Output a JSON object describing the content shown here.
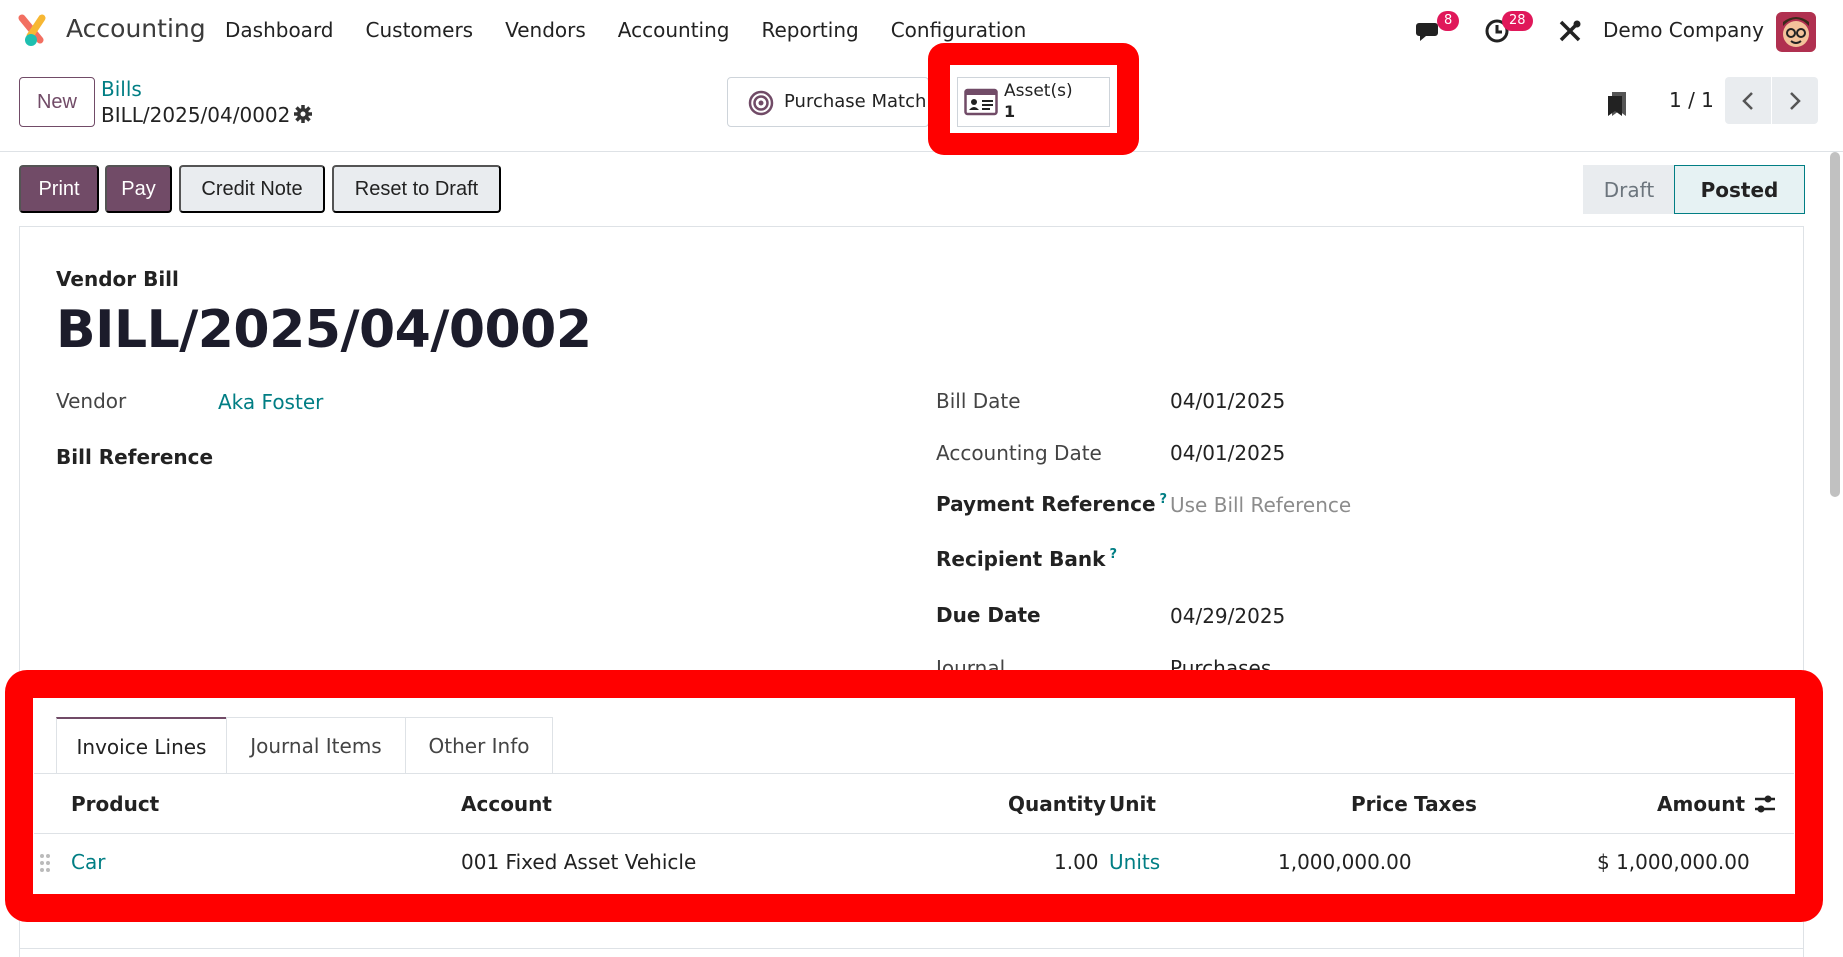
{
  "navbar": {
    "app_name": "Accounting",
    "menu": [
      "Dashboard",
      "Customers",
      "Vendors",
      "Accounting",
      "Reporting",
      "Configuration"
    ],
    "messages_count": "8",
    "activities_count": "28",
    "company": "Demo Company"
  },
  "control_panel": {
    "new_label": "New",
    "breadcrumb_parent": "Bills",
    "breadcrumb_current": "BILL/2025/04/0002",
    "smart_purchase_label": "Purchase Matching",
    "smart_asset_label": "Asset(s)",
    "smart_asset_count": "1",
    "pager": "1 / 1"
  },
  "actions": {
    "print": "Print",
    "pay": "Pay",
    "credit_note": "Credit Note",
    "reset_to_draft": "Reset to Draft"
  },
  "status": {
    "draft": "Draft",
    "posted": "Posted"
  },
  "form": {
    "doc_type": "Vendor Bill",
    "title": "BILL/2025/04/0002",
    "vendor_label": "Vendor",
    "vendor_value": "Aka Foster",
    "bill_reference_label": "Bill Reference",
    "bill_date_label": "Bill Date",
    "bill_date_value": "04/01/2025",
    "accounting_date_label": "Accounting Date",
    "accounting_date_value": "04/01/2025",
    "payment_reference_label": "Payment Reference",
    "payment_reference_placeholder": "Use Bill Reference",
    "recipient_bank_label": "Recipient Bank",
    "due_date_label": "Due Date",
    "due_date_value": "04/29/2025",
    "journal_label": "Journal",
    "journal_value": "Purchases",
    "help_mark": "?"
  },
  "notebook": {
    "tabs": [
      "Invoice Lines",
      "Journal Items",
      "Other Info"
    ],
    "columns": {
      "product": "Product",
      "account": "Account",
      "quantity": "Quantity",
      "unit": "Unit",
      "price": "Price",
      "taxes": "Taxes",
      "amount": "Amount"
    },
    "rows": [
      {
        "product": "Car",
        "account": "001 Fixed Asset Vehicle",
        "quantity": "1.00",
        "unit": "Units",
        "price": "1,000,000.00",
        "taxes": "",
        "amount": "$ 1,000,000.00"
      }
    ]
  },
  "colors": {
    "primary": "#714b67",
    "link": "#017e84",
    "highlight": "#ff0000",
    "badge": "#e0185a"
  },
  "icons": [
    "app-logo-icon",
    "chat-icon",
    "clock-icon",
    "tools-icon",
    "gear-icon",
    "target-icon",
    "id-card-icon",
    "bookmark-icon",
    "chevron-left-icon",
    "chevron-right-icon",
    "drag-handle-icon",
    "column-settings-icon"
  ]
}
